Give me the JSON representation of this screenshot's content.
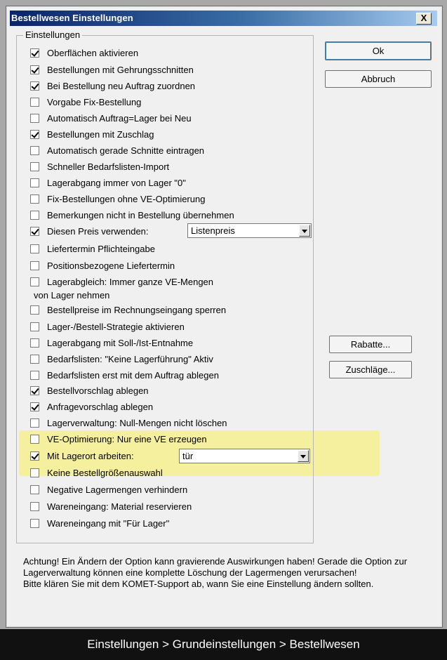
{
  "window": {
    "title": "Bestellwesen Einstellungen",
    "close_label": "X"
  },
  "group": {
    "legend": "Einstellungen"
  },
  "options": [
    {
      "label": "Oberflächen aktivieren",
      "checked": true
    },
    {
      "label": "Bestellungen mit Gehrungsschnitten",
      "checked": true
    },
    {
      "label": "Bei Bestellung neu Auftrag zuordnen",
      "checked": true
    },
    {
      "label": "Vorgabe Fix-Bestellung",
      "checked": false
    },
    {
      "label": "Automatisch Auftrag=Lager bei Neu",
      "checked": false
    },
    {
      "label": "Bestellungen mit Zuschlag",
      "checked": true
    },
    {
      "label": "Automatisch gerade Schnitte eintragen",
      "checked": false
    },
    {
      "label": "Schneller Bedarfslisten-Import",
      "checked": false
    },
    {
      "label": "Lagerabgang immer von Lager \"0\"",
      "checked": false
    },
    {
      "label": "Fix-Bestellungen ohne VE-Optimierung",
      "checked": false
    },
    {
      "label": "Bemerkungen nicht in Bestellung übernehmen",
      "checked": false
    },
    {
      "label": "Diesen Preis verwenden:",
      "checked": true
    },
    {
      "label": "Liefertermin Pflichteingabe",
      "checked": false
    },
    {
      "label": "Positionsbezogene Liefertermin",
      "checked": false
    },
    {
      "label": "Lagerabgleich: Immer ganze VE-Mengen",
      "checked": false
    },
    {
      "label": "Bestellpreise im Rechnungseingang sperren",
      "checked": false
    },
    {
      "label": "Lager-/Bestell-Strategie aktivieren",
      "checked": false
    },
    {
      "label": "Lagerabgang mit Soll-/Ist-Entnahme",
      "checked": false
    },
    {
      "label": "Bedarfslisten: \"Keine Lagerführung\" Aktiv",
      "checked": false
    },
    {
      "label": "Bedarfslisten erst mit dem Auftrag ablegen",
      "checked": false
    },
    {
      "label": "Bestellvorschlag ablegen",
      "checked": true
    },
    {
      "label": "Anfragevorschlag ablegen",
      "checked": true
    },
    {
      "label": "Lagerverwaltung: Null-Mengen nicht löschen",
      "checked": false
    },
    {
      "label": "VE-Optimierung: Nur eine VE erzeugen",
      "checked": false
    },
    {
      "label": "Mit Lagerort arbeiten:",
      "checked": true
    },
    {
      "label": "Keine Bestellgrößenauswahl",
      "checked": false
    },
    {
      "label": "Negative Lagermengen verhindern",
      "checked": false
    },
    {
      "label": "Wareneingang: Material reservieren",
      "checked": false
    },
    {
      "label": "Wareneingang mit \"Für Lager\"",
      "checked": false
    }
  ],
  "option_continuation": "von Lager nehmen",
  "price_select": {
    "value": "Listenpreis"
  },
  "lagerort_select": {
    "value": "tür"
  },
  "buttons": {
    "ok": "Ok",
    "cancel": "Abbruch",
    "rabatte": "Rabatte...",
    "zuschlaege": "Zuschläge..."
  },
  "note": [
    "Achtung! Ein Ändern der Option kann gravierende Auswirkungen haben! Gerade die Option zur Lagerverwaltung können eine komplette Löschung der Lagermengen verursachen!",
    "Bitte klären Sie mit dem KOMET-Support ab, wann Sie eine Einstellung ändern sollten."
  ],
  "caption": "Einstellungen > Grundeinstellungen > Bestellwesen"
}
